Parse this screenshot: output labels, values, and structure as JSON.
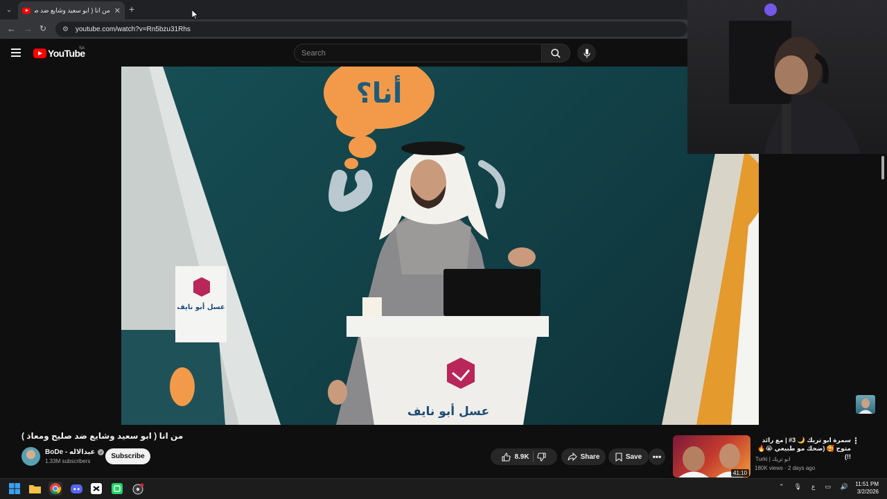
{
  "browser": {
    "tab_title": "من انا ( ابو سعيد وشايع ضد صلي",
    "url": "youtube.com/watch?v=Rn5bzu31Rhs"
  },
  "youtube": {
    "logo_text": "YouTube",
    "region": "SA",
    "search_placeholder": "Search"
  },
  "video": {
    "title": "من انا ( ابو سعيد وشايع ضد صليح ومعاذ )",
    "channel": {
      "name": "BoDe - عبدالاله",
      "subscribers": "1.33M subscribers"
    },
    "subscribe_label": "Subscribe",
    "actions": {
      "likes": "8.9K",
      "share_label": "Share",
      "save_label": "Save"
    },
    "scene_text": {
      "sign_top": "أنا؟",
      "podium_brand": "عسل أبو نايف",
      "side_sign": "عسل أبو نايف"
    }
  },
  "suggested": {
    "title": "سمرة ابو تريك 🌙 3# | مع رائد متوح 🥰 (ضحك مو طبيعي 😭🔥 !!)",
    "channel": "Turki | ابو تريك",
    "meta": "180K views · 2 days ago",
    "duration": "41:10"
  },
  "taskbar": {
    "time": "11:51 PM",
    "date": "3/2/2026",
    "lang": "ع"
  },
  "colors": {
    "yt_red": "#ff0000",
    "bg": "#0f0f0f",
    "video_teal": "#164f55",
    "sign_orange": "#f39a4a"
  }
}
